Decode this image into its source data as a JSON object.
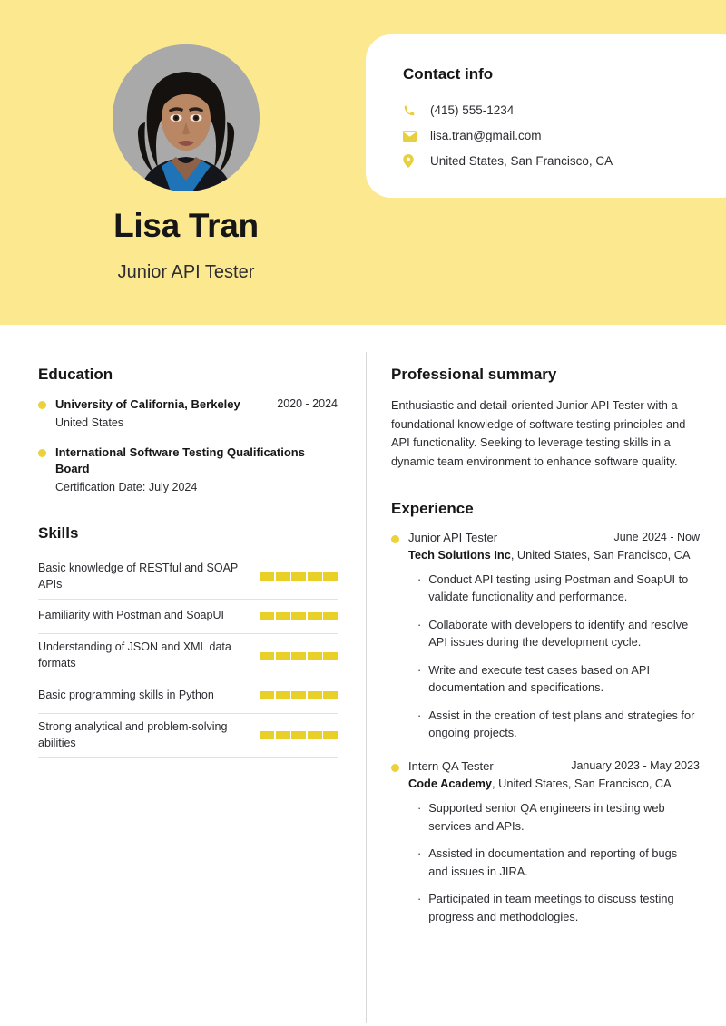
{
  "header": {
    "name": "Lisa Tran",
    "job_title": "Junior API Tester",
    "background_color": "#fbe88f",
    "avatar": "profile-photo"
  },
  "contact": {
    "title": "Contact info",
    "items": [
      {
        "icon": "phone-icon",
        "value": "(415) 555-1234"
      },
      {
        "icon": "email-icon",
        "value": "lisa.tran@gmail.com"
      },
      {
        "icon": "location-icon",
        "value": "United States, San Francisco, CA"
      }
    ]
  },
  "education": {
    "title": "Education",
    "items": [
      {
        "school": "University of California, Berkeley",
        "date": "2020 - 2024",
        "sub": "United States"
      },
      {
        "school": "International Software Testing Qualifications Board",
        "date": "",
        "sub": "Certification Date: July 2024"
      }
    ]
  },
  "skills": {
    "title": "Skills",
    "accent_color": "#e8d029",
    "max_level": 5,
    "items": [
      {
        "name": "Basic knowledge of RESTful and SOAP APIs",
        "level": 5
      },
      {
        "name": "Familiarity with Postman and SoapUI",
        "level": 5
      },
      {
        "name": "Understanding of JSON and XML data formats",
        "level": 5
      },
      {
        "name": "Basic programming skills in Python",
        "level": 5
      },
      {
        "name": "Strong analytical and problem-solving abilities",
        "level": 5
      }
    ]
  },
  "summary": {
    "title": "Professional summary",
    "text": "Enthusiastic and detail-oriented Junior API Tester with a foundational knowledge of software testing principles and API functionality. Seeking to leverage testing skills in a dynamic team environment to enhance software quality."
  },
  "experience": {
    "title": "Experience",
    "items": [
      {
        "role": "Junior API Tester",
        "date": "June 2024 - Now",
        "company": "Tech Solutions Inc",
        "location": ", United States, San Francisco, CA",
        "bullets": [
          "Conduct API testing using Postman and SoapUI to validate functionality and performance.",
          "Collaborate with developers to identify and resolve API issues during the development cycle.",
          "Write and execute test cases based on API documentation and specifications.",
          "Assist in the creation of test plans and strategies for ongoing projects."
        ]
      },
      {
        "role": "Intern QA Tester",
        "date": "January 2023 - May 2023",
        "company": "Code Academy",
        "location": ", United States, San Francisco, CA",
        "bullets": [
          "Supported senior QA engineers in testing web services and APIs.",
          "Assisted in documentation and reporting of bugs and issues in JIRA.",
          "Participated in team meetings to discuss testing progress and methodologies."
        ]
      }
    ]
  }
}
